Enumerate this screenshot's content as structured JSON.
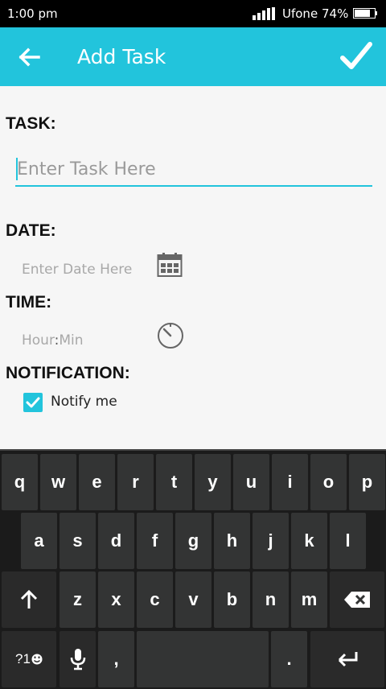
{
  "status_bar": {
    "time": "1:00 pm",
    "carrier": "Ufone",
    "battery": "74%"
  },
  "app_bar": {
    "title": "Add Task"
  },
  "form": {
    "task_label": "TASK:",
    "task_placeholder": "Enter Task Here",
    "date_label": "DATE:",
    "date_placeholder": "Enter Date Here",
    "time_label": "TIME:",
    "time_hour": "Hour",
    "time_sep": ":",
    "time_min": "Min",
    "notification_label": "NOTIFICATION:",
    "notify_text": "Notify me",
    "notify_checked": true
  },
  "keyboard": {
    "row1": [
      "q",
      "w",
      "e",
      "r",
      "t",
      "y",
      "u",
      "i",
      "o",
      "p"
    ],
    "row2": [
      "a",
      "s",
      "d",
      "f",
      "g",
      "h",
      "j",
      "k",
      "l"
    ],
    "row3": [
      "z",
      "x",
      "c",
      "v",
      "b",
      "n",
      "m"
    ],
    "symbols_label": "?1",
    "comma": ",",
    "period": "."
  },
  "colors": {
    "accent": "#22c4dc",
    "keyboard_bg": "#1b1b1b",
    "key_bg": "#333434"
  }
}
